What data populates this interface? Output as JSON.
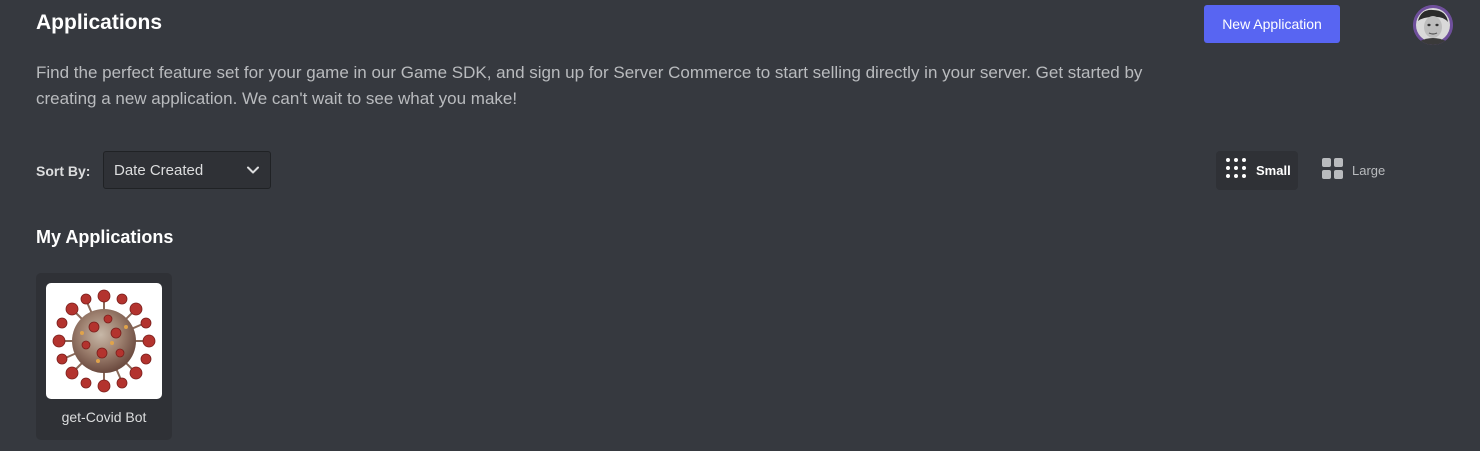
{
  "header": {
    "title": "Applications",
    "new_application_label": "New Application"
  },
  "description": "Find the perfect feature set for your game in our Game SDK, and sign up for Server Commerce to start selling directly in your server. Get started by creating a new application. We can't wait to see what you make!",
  "sort": {
    "label": "Sort By:",
    "selected": "Date Created"
  },
  "view_toggle": {
    "small_label": "Small",
    "large_label": "Large",
    "active": "small"
  },
  "my_applications": {
    "title": "My Applications",
    "apps": [
      {
        "name": "get-Covid Bot",
        "icon": "coronavirus-image"
      }
    ]
  },
  "colors": {
    "background": "#36393f",
    "accent": "#5865f2",
    "card": "#2f3136"
  },
  "icons": {
    "dropdown": "chevron-down-icon",
    "small_view": "grid-small-icon",
    "large_view": "grid-large-icon",
    "avatar": "user-avatar"
  }
}
